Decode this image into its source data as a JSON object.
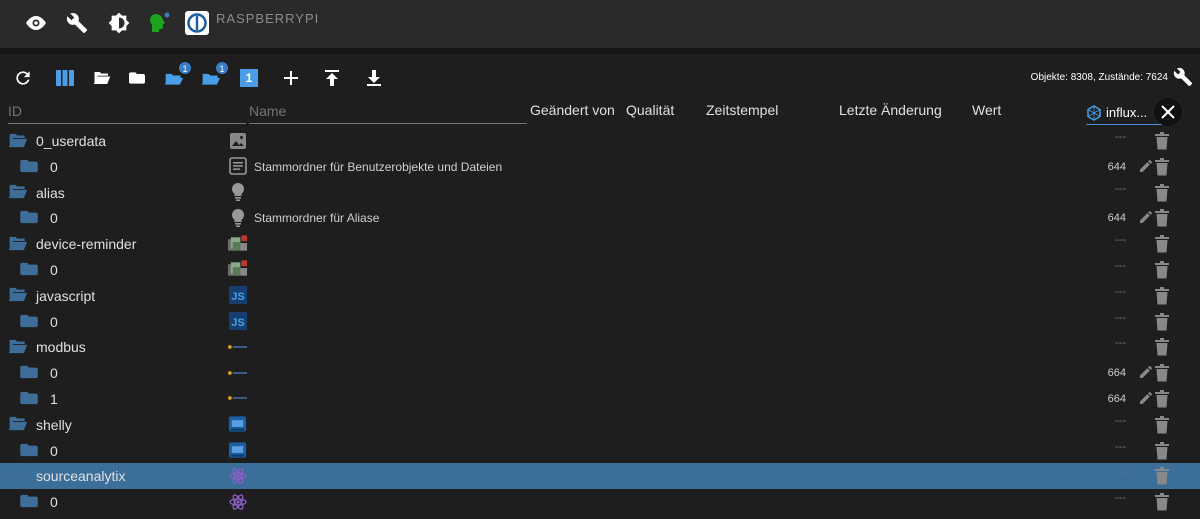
{
  "topbar": {
    "icons": [
      "eye-icon",
      "wrench-icon",
      "brightness-icon",
      "expert-head-icon",
      "iobroker-logo"
    ],
    "brand": "RASPBERRYPI"
  },
  "toolbar": {
    "icons": [
      "refresh-icon",
      "columns-icon",
      "folder-open-icon",
      "folder-icon",
      "cloud-badge-icon",
      "cloud-badge-icon-2",
      "one-level-icon",
      "add-icon",
      "upload-icon",
      "download-icon"
    ],
    "badge_1": "1",
    "badge_2": "1",
    "level_label": "1",
    "stats": "Objekte: 8308, Zustände: 7624"
  },
  "columns": {
    "id": "ID",
    "name": "Name",
    "changed_by": "Geändert von",
    "quality": "Qualität",
    "timestamp": "Zeitstempel",
    "last_change": "Letzte Änderung",
    "value": "Wert",
    "filter_value": "influx..."
  },
  "rows": [
    {
      "id": "0_userdata",
      "level": 0,
      "type": "image-icon",
      "desc": "",
      "value": "---",
      "edit": false
    },
    {
      "id": "0",
      "level": 1,
      "type": "document-icon",
      "desc": "Stammordner für Benutzerobjekte und Dateien",
      "value": "644",
      "edit": true
    },
    {
      "id": "alias",
      "level": 0,
      "type": "bulb-icon",
      "desc": "",
      "value": "---",
      "edit": false
    },
    {
      "id": "0",
      "level": 1,
      "type": "bulb-icon",
      "desc": "Stammordner für Aliase",
      "value": "644",
      "edit": true
    },
    {
      "id": "device-reminder",
      "level": 0,
      "type": "device-reminder-icon",
      "desc": "",
      "value": "---",
      "edit": false
    },
    {
      "id": "0",
      "level": 1,
      "type": "device-reminder-icon",
      "desc": "",
      "value": "---",
      "edit": false
    },
    {
      "id": "javascript",
      "level": 0,
      "type": "javascript-icon",
      "desc": "",
      "value": "---",
      "edit": false
    },
    {
      "id": "0",
      "level": 1,
      "type": "javascript-icon",
      "desc": "",
      "value": "---",
      "edit": false
    },
    {
      "id": "modbus",
      "level": 0,
      "type": "modbus-icon",
      "desc": "",
      "value": "---",
      "edit": false
    },
    {
      "id": "0",
      "level": 1,
      "type": "modbus-icon",
      "desc": "",
      "value": "664",
      "edit": true
    },
    {
      "id": "1",
      "level": 1,
      "type": "modbus-icon",
      "desc": "",
      "value": "664",
      "edit": true
    },
    {
      "id": "shelly",
      "level": 0,
      "type": "shelly-icon",
      "desc": "",
      "value": "---",
      "edit": false
    },
    {
      "id": "0",
      "level": 1,
      "type": "shelly-icon",
      "desc": "",
      "value": "---",
      "edit": false
    },
    {
      "id": "sourceanalytix",
      "level": 0,
      "type": "atom-icon",
      "desc": "",
      "value": "---",
      "edit": false,
      "selected": true
    },
    {
      "id": "0",
      "level": 1,
      "type": "atom-icon",
      "desc": "",
      "value": "---",
      "edit": false
    }
  ]
}
